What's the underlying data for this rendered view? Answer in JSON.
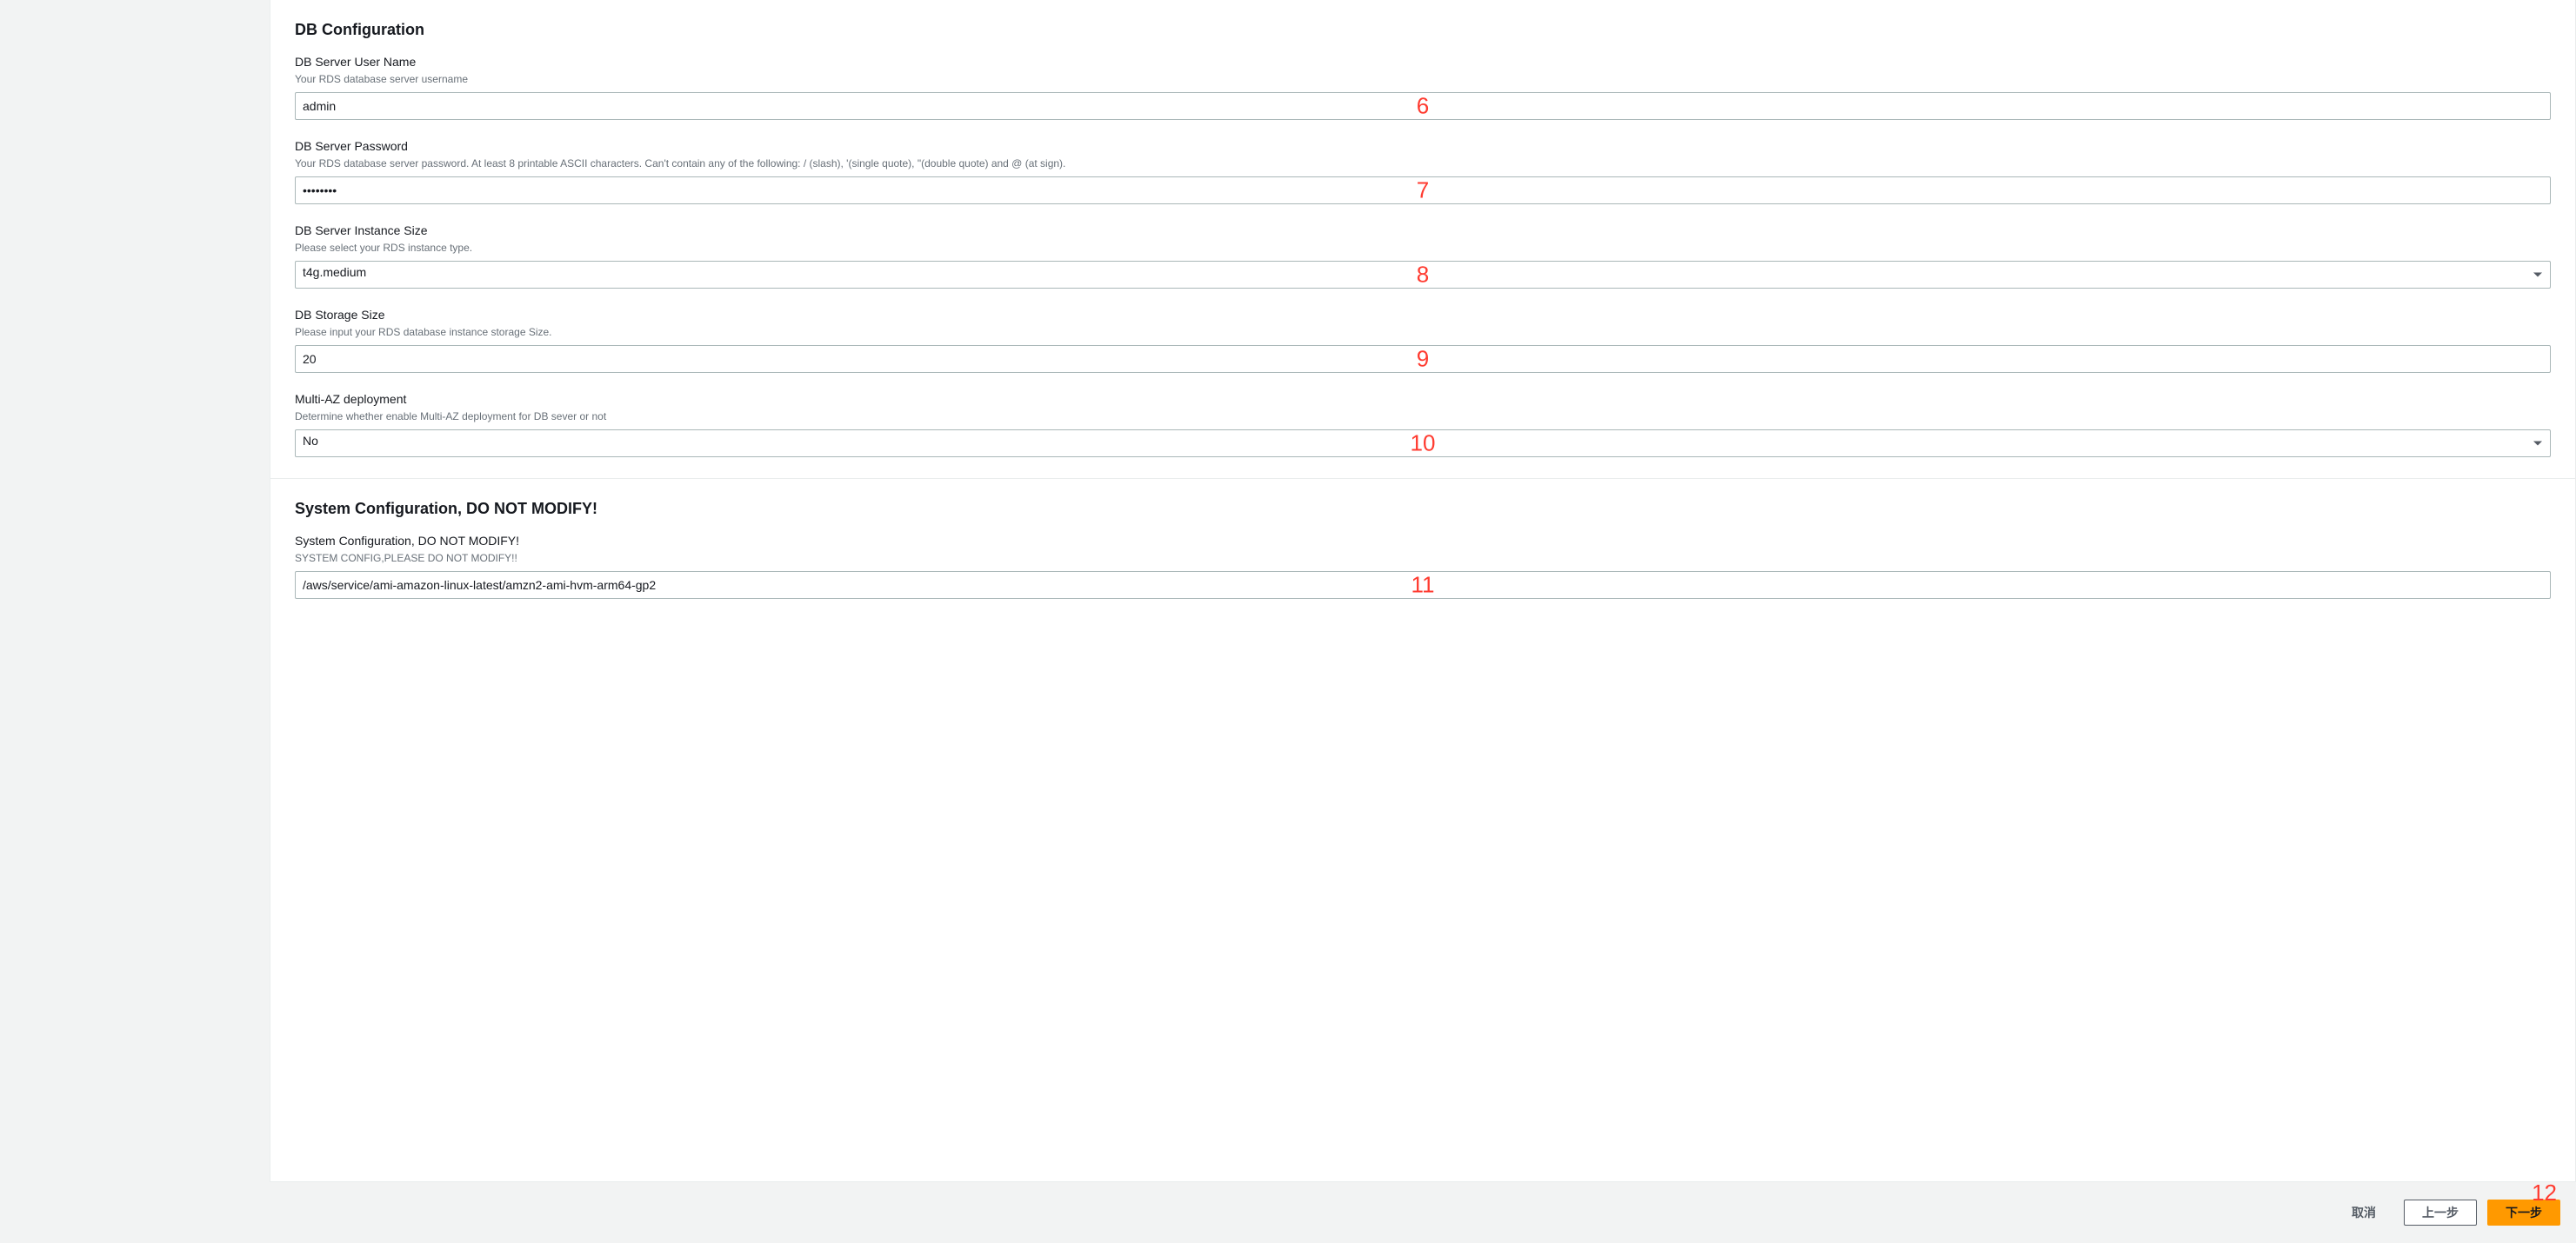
{
  "sections": {
    "db": {
      "title": "DB Configuration",
      "fields": {
        "username": {
          "label": "DB Server User Name",
          "description": "Your RDS database server username",
          "value": "admin",
          "annotation": "6"
        },
        "password": {
          "label": "DB Server Password",
          "description": "Your RDS database server password. At least 8 printable ASCII characters. Can't contain any of the following: / (slash), '(single quote), \"(double quote) and @ (at sign).",
          "value": "••••••••",
          "annotation": "7"
        },
        "instance_size": {
          "label": "DB Server Instance Size",
          "description": "Please select your RDS instance type.",
          "value": "t4g.medium",
          "annotation": "8"
        },
        "storage_size": {
          "label": "DB Storage Size",
          "description": "Please input your RDS database instance storage Size.",
          "value": "20",
          "annotation": "9"
        },
        "multi_az": {
          "label": "Multi-AZ deployment",
          "description": "Determine whether enable Multi-AZ deployment for DB sever or not",
          "value": "No",
          "annotation": "10"
        }
      }
    },
    "system": {
      "title": "System Configuration, DO NOT MODIFY!",
      "fields": {
        "config": {
          "label": "System Configuration, DO NOT MODIFY!",
          "description": "SYSTEM CONFIG,PLEASE DO NOT MODIFY!!",
          "value": "/aws/service/ami-amazon-linux-latest/amzn2-ami-hvm-arm64-gp2",
          "annotation": "11"
        }
      }
    }
  },
  "footer": {
    "cancel": "取消",
    "previous": "上一步",
    "next": "下一步",
    "annotation": "12"
  }
}
